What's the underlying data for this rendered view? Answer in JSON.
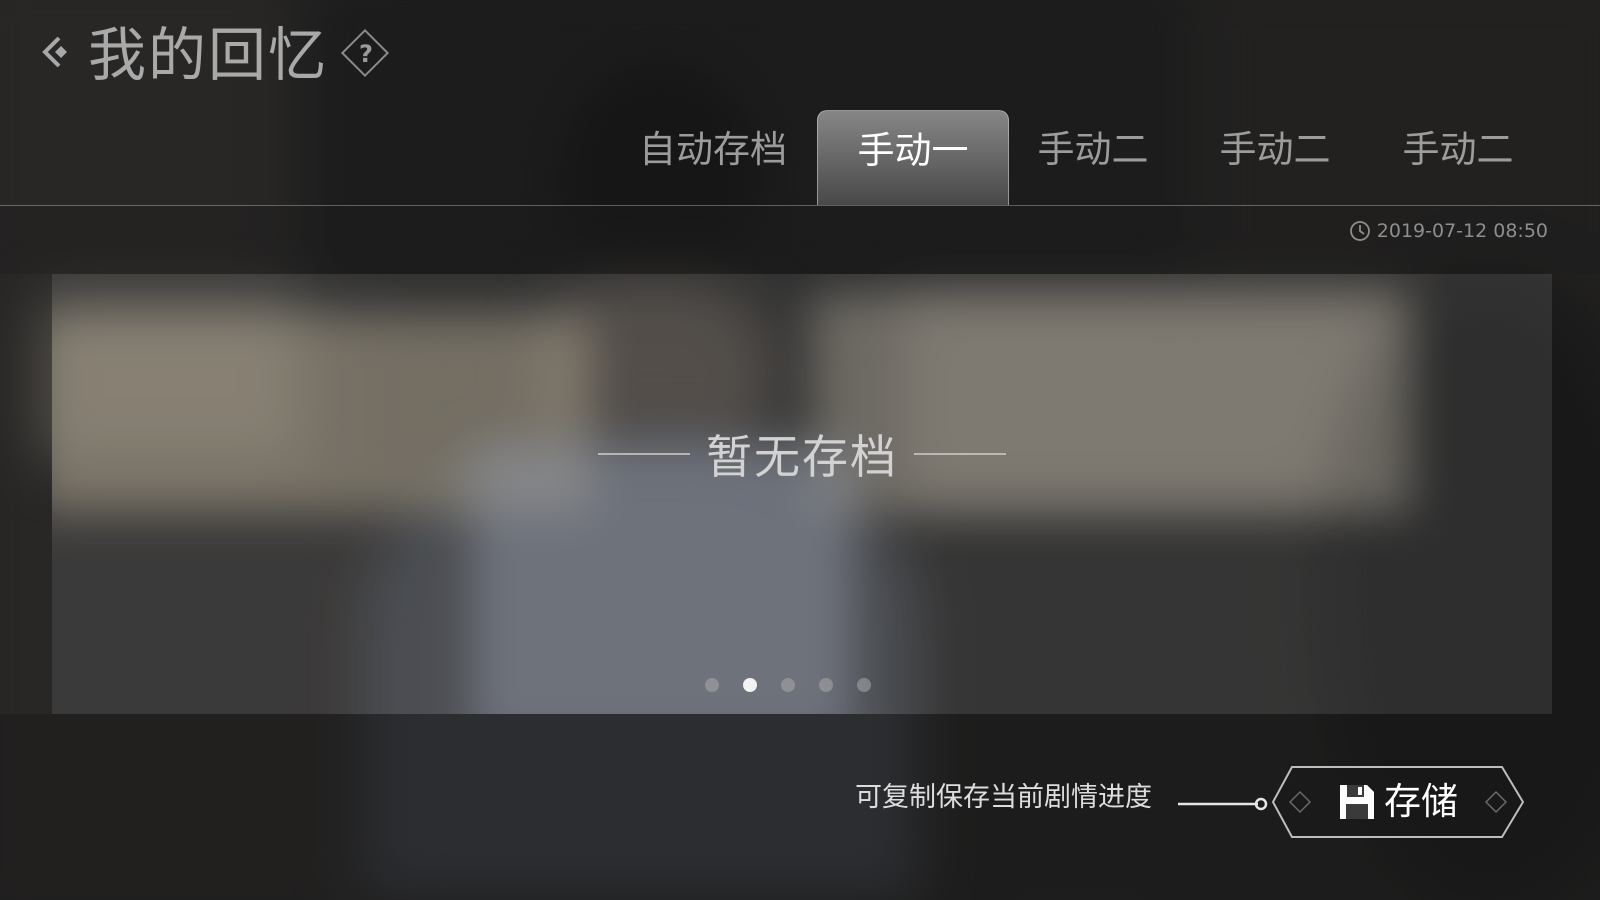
{
  "header": {
    "title": "我的回忆",
    "help_label": "?"
  },
  "tabs": [
    {
      "label": "自动存档",
      "active": false
    },
    {
      "label": "手动一",
      "active": true
    },
    {
      "label": "手动二",
      "active": false
    },
    {
      "label": "手动二",
      "active": false
    },
    {
      "label": "手动二",
      "active": false
    }
  ],
  "slot": {
    "timestamp": "2019-07-12  08:50",
    "empty_text": "暂无存档",
    "page_count": 5,
    "current_page": 2
  },
  "action": {
    "hint": "可复制保存当前剧情进度",
    "save_label": "存储"
  },
  "icons": {
    "back": "chevron-left-icon",
    "help": "question-icon",
    "clock": "clock-icon",
    "save": "floppy-disk-icon"
  }
}
